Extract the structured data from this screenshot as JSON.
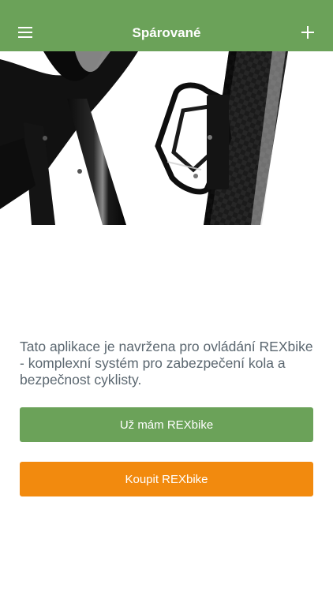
{
  "header": {
    "title": "Spárované",
    "menu_icon": "hamburger-menu-icon",
    "add_icon": "plus-icon"
  },
  "hero": {
    "image": "carbon bike frame with bottle cage photo"
  },
  "intro": {
    "text": "Tato aplikace je navržena pro ovládání REXbike - komplexní systém pro zabezpečení kola a bezpečnost cyklisty."
  },
  "actions": {
    "have_label": "Už mám REXbike",
    "buy_label": "Koupit REXbike"
  },
  "colors": {
    "primary": "#6ba259",
    "accent": "#f28a0e",
    "text": "#5b6770"
  }
}
